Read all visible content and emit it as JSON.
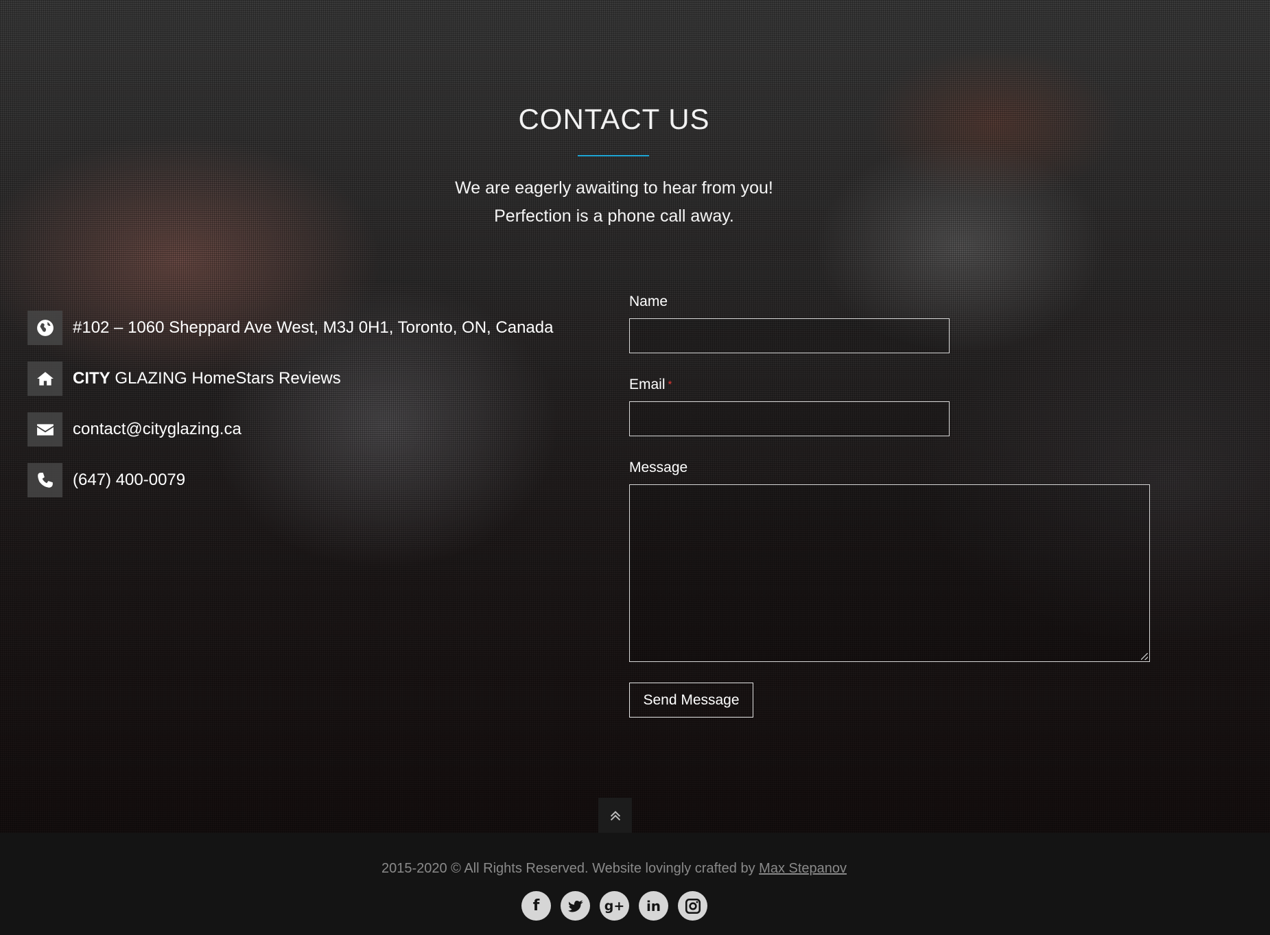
{
  "header": {
    "title": "CONTACT US",
    "subtitle_line1": "We are eagerly awaiting to hear from you!",
    "subtitle_line2": "Perfection is a phone call away.",
    "accent_color": "#1ea7d6"
  },
  "contact_info": {
    "address": {
      "icon": "globe-icon",
      "text": "#102 – 1060 Sheppard Ave West, M3J 0H1, Toronto, ON, Canada"
    },
    "reviews": {
      "icon": "home-icon",
      "brand_bold": "CITY",
      "text": " GLAZING HomeStars Reviews"
    },
    "email": {
      "icon": "envelope-icon",
      "text": "contact@cityglazing.ca"
    },
    "phone": {
      "icon": "phone-icon",
      "text": "(647) 400-0079"
    }
  },
  "form": {
    "name_label": "Name",
    "name_value": "",
    "email_label": "Email",
    "email_required_marker": "*",
    "email_value": "",
    "message_label": "Message",
    "message_value": "",
    "submit_label": "Send Message"
  },
  "scroll_top": {
    "icon": "chevron-double-up-icon"
  },
  "footer": {
    "copyright_text": "2015-2020 © All Rights Reserved. Website lovingly crafted by ",
    "author_link": "Max Stepanov",
    "socials": [
      {
        "name": "facebook-icon",
        "glyph": "f"
      },
      {
        "name": "twitter-icon",
        "glyph": ""
      },
      {
        "name": "google-plus-icon",
        "glyph": "g+"
      },
      {
        "name": "linkedin-icon",
        "glyph": "in"
      },
      {
        "name": "instagram-icon",
        "glyph": ""
      }
    ]
  }
}
